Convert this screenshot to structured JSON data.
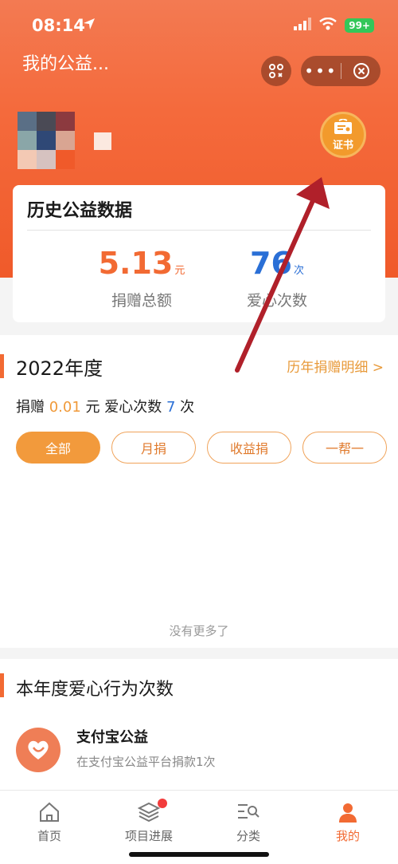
{
  "status_bar": {
    "time": "08:14",
    "battery": "99+"
  },
  "header": {
    "title": "我的公益...",
    "certificate_label": "证书"
  },
  "history": {
    "title": "历史公益数据",
    "donation_value": "5.13",
    "donation_unit": "元",
    "donation_label": "捐赠总额",
    "love_value": "76",
    "love_unit": "次",
    "love_label": "爱心次数"
  },
  "year": {
    "title": "2022年度",
    "detail_link": "历年捐赠明细 >",
    "summary_prefix": "捐赠 ",
    "amount": "0.01",
    "summary_mid": " 元  爱心次数 ",
    "count": "7",
    "summary_suffix": " 次",
    "filters": [
      "全部",
      "月捐",
      "收益捐",
      "一帮一"
    ],
    "no_more": "没有更多了"
  },
  "love": {
    "title": "本年度爱心行为次数",
    "item_name": "支付宝公益",
    "item_desc": "在支付宝公益平台捐款1次"
  },
  "tabbar": {
    "items": [
      "首页",
      "项目进展",
      "分类",
      "我的"
    ]
  },
  "colors": {
    "brand": "#f26a33",
    "accent": "#f29a3c",
    "blue": "#2a6fd6"
  }
}
